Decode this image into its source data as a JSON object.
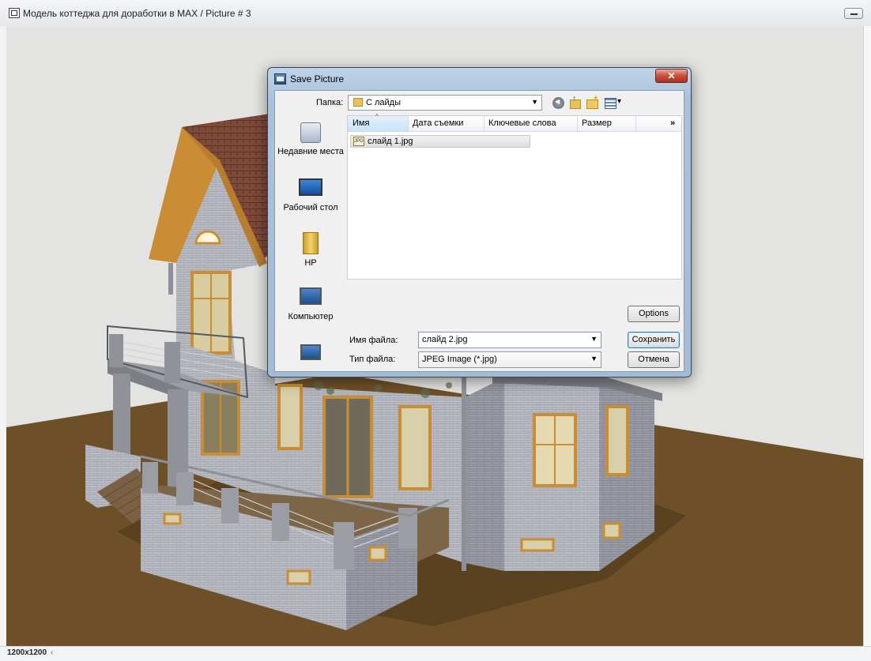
{
  "window": {
    "title": "Модель коттеджа для доработки в MAX / Picture # 3"
  },
  "statusbar": {
    "resolution": "1200x1200",
    "arrow": "‹"
  },
  "dialog": {
    "title": "Save Picture",
    "close_label": "✕",
    "folder_label": "Папка:",
    "folder_value": "С лайды",
    "places": [
      {
        "label": "Недавние места",
        "icon": "recent-places-icon"
      },
      {
        "label": "Рабочий стол",
        "icon": "desktop-icon"
      },
      {
        "label": "HP",
        "icon": "user-folder-icon"
      },
      {
        "label": "Компьютер",
        "icon": "computer-icon"
      },
      {
        "label": "",
        "icon": "network-icon"
      }
    ],
    "columns": {
      "name": "Имя",
      "date": "Дата съемки",
      "keywords": "Ключевые слова",
      "size": "Размер",
      "more": "»"
    },
    "files": [
      {
        "name": "слайд 1.jpg",
        "icon": "jpg-file-icon",
        "icon_text": "JPG"
      }
    ],
    "options_label": "Options",
    "save_label": "Сохранить",
    "cancel_label": "Отмена",
    "filename_label": "Имя файла:",
    "filename_value": "слайд 2.jpg",
    "filetype_label": "Тип файла:",
    "filetype_value": "JPEG Image (*.jpg)"
  },
  "colors": {
    "ground": "#6e5028",
    "background": "#e3e3e1",
    "roof": "#7d4a3a",
    "brick": "#b9bcc3",
    "window_frame": "#c98d35",
    "dialog_frame": "#a9c2dc"
  }
}
